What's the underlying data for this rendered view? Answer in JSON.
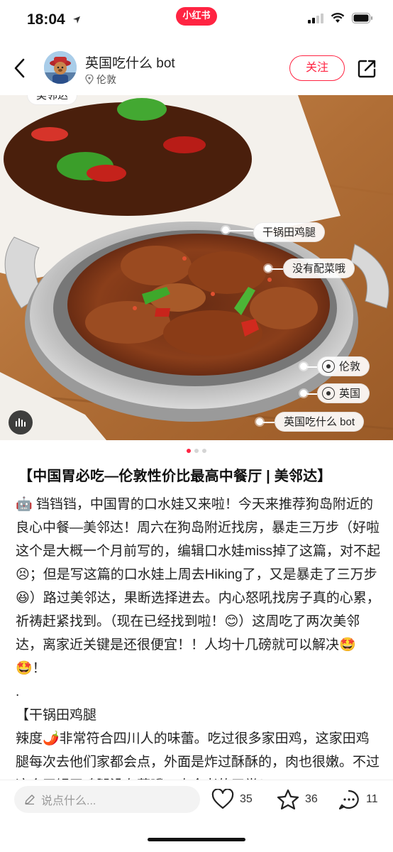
{
  "status_bar": {
    "time": "18:04",
    "brand_label": "小红书"
  },
  "header": {
    "author_name": "英国吃什么 bot",
    "location": "伦敦",
    "follow_label": "关注"
  },
  "photo": {
    "tags": {
      "top_cut": "美邻达",
      "dish": "干锅田鸡腿",
      "no_veg": "没有配菜哦",
      "city": "伦敦",
      "country": "英国",
      "account": "英国吃什么 bot"
    },
    "pages_total": 3,
    "page_active": 1
  },
  "post": {
    "title": "【中国胃必吃—伦敦性价比最高中餐厅 | 美邻达】",
    "paragraphs": [
      "🤖 铛铛铛，中国胃的口水娃又来啦！今天来推荐狗岛附近的良心中餐—美邻达！周六在狗岛附近找房，暴走三万步（好啦这个是大概一个月前写的，编辑口水娃miss掉了这篇，对不起😣；但是写这篇的口水娃上周去Hiking了，又是暴走了三万步😆）路过美邻达，果断选择进去。内心怒吼找房子真的心累，祈祷赶紧找到。（现在已经找到啦！😊）这周吃了两次美邻达，离家近关键是还很便宜！！人均十几磅就可以解决🤩🤩！",
      ".",
      "【干锅田鸡腿",
      "辣度🌶️非常符合四川人的味蕾。吃过很多家田鸡，这家田鸡腿每次去他们家都会点，外面是炸过酥酥的，肉也很嫩。不过这个干锅田鸡腿没有菜哦～肉食者的天堂！"
    ]
  },
  "bottom_bar": {
    "comment_placeholder": "说点什么...",
    "like_count": "35",
    "collect_count": "36",
    "comment_count": "11"
  },
  "colors": {
    "brand": "#ff2442"
  }
}
